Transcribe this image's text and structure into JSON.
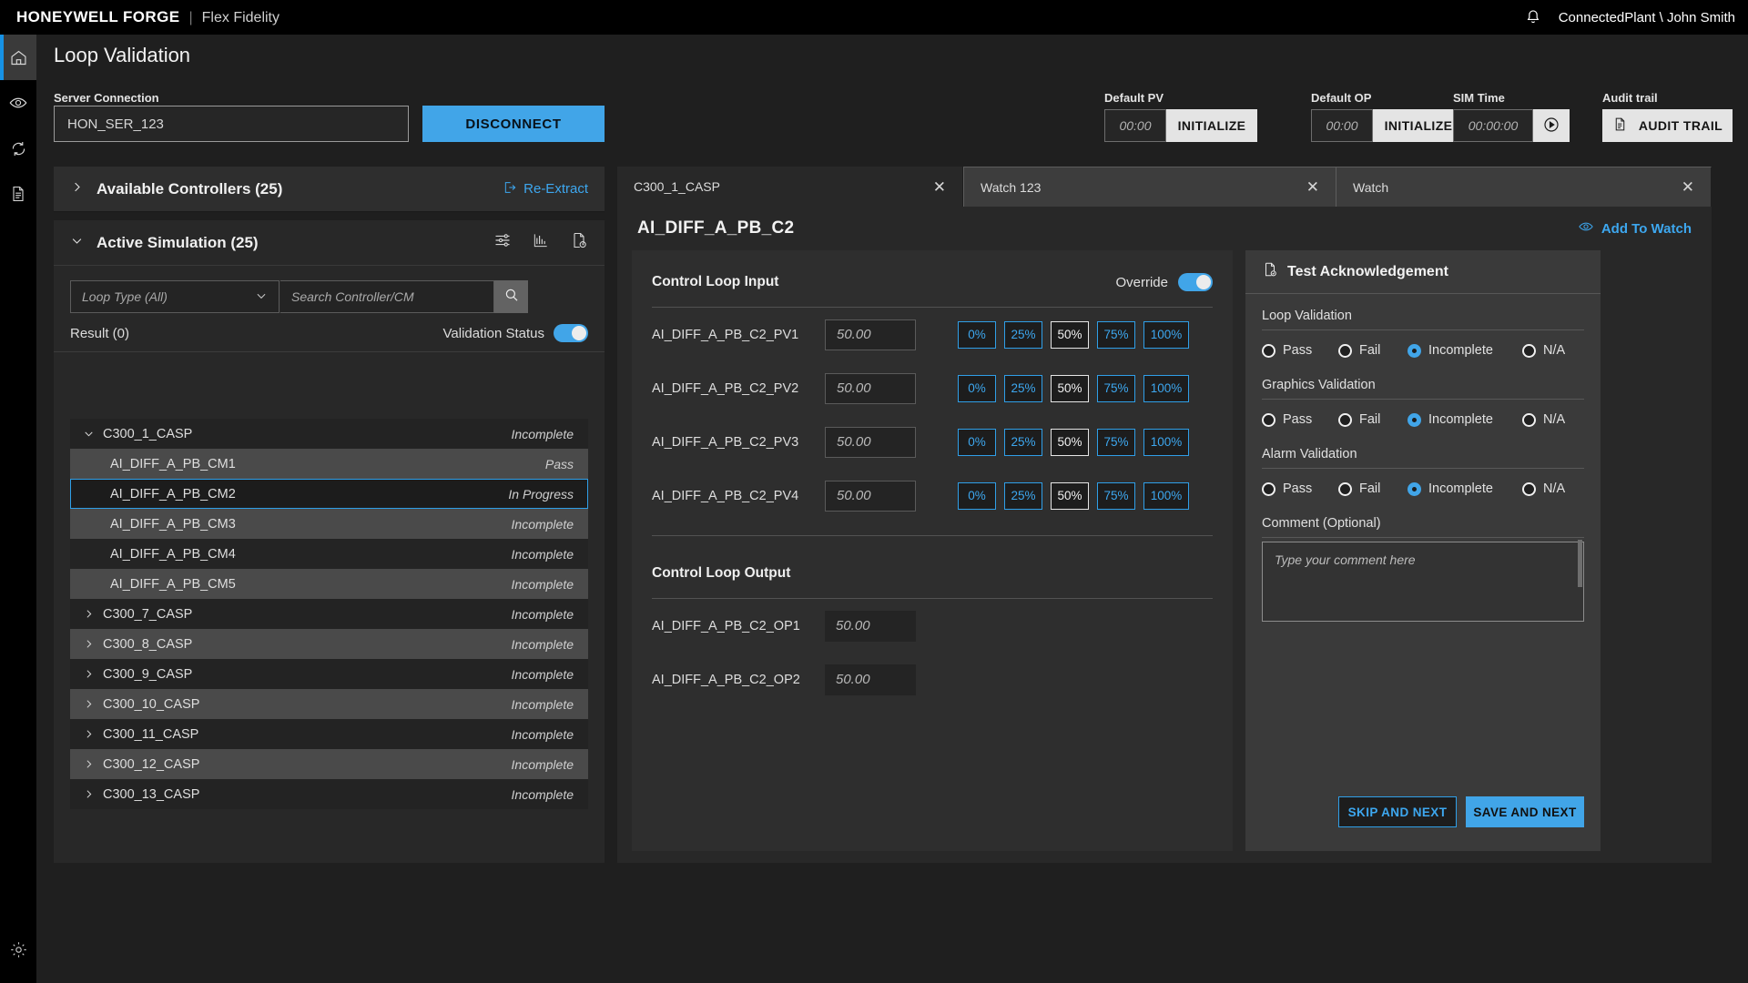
{
  "topbar": {
    "brand_main": "HONEYWELL FORGE",
    "brand_separator": "|",
    "brand_sub": "Flex Fidelity",
    "notification_icon": "bell-icon",
    "user": "ConnectedPlant \\ John Smith"
  },
  "rail": {
    "items": [
      {
        "name": "home-icon",
        "active": true
      },
      {
        "name": "eye-icon",
        "active": false
      },
      {
        "name": "sync-icon",
        "active": false
      },
      {
        "name": "document-list-icon",
        "active": false
      }
    ],
    "bottom": {
      "name": "gear-icon"
    }
  },
  "page": {
    "title": "Loop Validation"
  },
  "server": {
    "label": "Server Connection",
    "value": "HON_SER_123",
    "disconnect_label": "DISCONNECT"
  },
  "toolbar": {
    "default_pv": {
      "label": "Default PV",
      "value": "00:00",
      "action": "INITIALIZE"
    },
    "default_op": {
      "label": "Default OP",
      "value": "00:00",
      "action": "INITIALIZE"
    },
    "sim_time": {
      "label": "SIM Time",
      "value": "00:00:00",
      "action_icon": "play-circle-icon"
    },
    "audit": {
      "label": "Audit trail",
      "button": "AUDIT TRAIL",
      "icon": "document-icon"
    }
  },
  "controllers": {
    "title": "Available Controllers (25)",
    "reextract": "Re-Extract",
    "reextract_icon": "export-icon",
    "expanded": false
  },
  "simulation": {
    "title": "Active Simulation (25)",
    "expanded": true,
    "icons": [
      "sliders-icon",
      "bar-chart-icon",
      "document-clock-icon"
    ],
    "loop_type": "Loop Type (All)",
    "search_placeholder": "Search Controller/CM",
    "search_value": "",
    "search_icon": "search-icon",
    "result_label": "Result (0)",
    "validation_status_label": "Validation Status",
    "validation_status_on": true,
    "tree": [
      {
        "label": "C300_1_CASP",
        "status": "Incomplete",
        "type": "parent",
        "expanded": true
      },
      {
        "label": "AI_DIFF_A_PB_CM1",
        "status": "Pass",
        "type": "child"
      },
      {
        "label": "AI_DIFF_A_PB_CM2",
        "status": "In Progress",
        "type": "child",
        "selected": true
      },
      {
        "label": "AI_DIFF_A_PB_CM3",
        "status": "Incomplete",
        "type": "child"
      },
      {
        "label": "AI_DIFF_A_PB_CM4",
        "status": "Incomplete",
        "type": "child"
      },
      {
        "label": "AI_DIFF_A_PB_CM5",
        "status": "Incomplete",
        "type": "child"
      },
      {
        "label": "C300_7_CASP",
        "status": "Incomplete",
        "type": "parent",
        "expanded": false
      },
      {
        "label": "C300_8_CASP",
        "status": "Incomplete",
        "type": "parent",
        "expanded": false
      },
      {
        "label": "C300_9_CASP",
        "status": "Incomplete",
        "type": "parent",
        "expanded": false
      },
      {
        "label": "C300_10_CASP",
        "status": "Incomplete",
        "type": "parent",
        "expanded": false
      },
      {
        "label": "C300_11_CASP",
        "status": "Incomplete",
        "type": "parent",
        "expanded": false
      },
      {
        "label": "C300_12_CASP",
        "status": "Incomplete",
        "type": "parent",
        "expanded": false
      },
      {
        "label": "C300_13_CASP",
        "status": "Incomplete",
        "type": "parent",
        "expanded": false
      }
    ]
  },
  "tabs": [
    {
      "label": "C300_1_CASP",
      "active": true,
      "close": "✕"
    },
    {
      "label": "Watch 123",
      "active": false,
      "close": "✕"
    },
    {
      "label": "Watch",
      "active": false,
      "close": "✕"
    }
  ],
  "loop": {
    "name": "AI_DIFF_A_PB_C2",
    "add_to_watch": "Add To Watch",
    "add_to_watch_icon": "eye-icon"
  },
  "control_loop_input": {
    "title": "Control Loop Input",
    "override_label": "Override",
    "override_on": true,
    "pct_options": [
      "0%",
      "25%",
      "50%",
      "75%",
      "100%"
    ],
    "rows": [
      {
        "label": "AI_DIFF_A_PB_C2_PV1",
        "value": "50.00",
        "selected_pct": "50%"
      },
      {
        "label": "AI_DIFF_A_PB_C2_PV2",
        "value": "50.00",
        "selected_pct": "50%"
      },
      {
        "label": "AI_DIFF_A_PB_C2_PV3",
        "value": "50.00",
        "selected_pct": "50%"
      },
      {
        "label": "AI_DIFF_A_PB_C2_PV4",
        "value": "50.00",
        "selected_pct": "50%"
      }
    ]
  },
  "control_loop_output": {
    "title": "Control Loop Output",
    "rows": [
      {
        "label": "AI_DIFF_A_PB_C2_OP1",
        "value": "50.00"
      },
      {
        "label": "AI_DIFF_A_PB_C2_OP2",
        "value": "50.00"
      }
    ]
  },
  "test_ack": {
    "title": "Test Acknowledgement",
    "title_icon": "document-check-icon",
    "groups": [
      {
        "label": "Loop Validation",
        "options": [
          "Pass",
          "Fail",
          "Incomplete",
          "N/A"
        ],
        "selected": "Incomplete"
      },
      {
        "label": "Graphics Validation",
        "options": [
          "Pass",
          "Fail",
          "Incomplete",
          "N/A"
        ],
        "selected": "Incomplete"
      },
      {
        "label": "Alarm Validation",
        "options": [
          "Pass",
          "Fail",
          "Incomplete",
          "N/A"
        ],
        "selected": "Incomplete"
      }
    ],
    "comment_label": "Comment (Optional)",
    "comment_placeholder": "Type your comment here",
    "comment_value": "",
    "skip_label": "SKIP AND NEXT",
    "save_label": "SAVE AND NEXT"
  },
  "colors": {
    "accent": "#41a5e8",
    "link": "#3da7ef",
    "page_bg": "#1f1f1f",
    "panel_bg": "#282828",
    "topbar_bg": "#000000"
  }
}
